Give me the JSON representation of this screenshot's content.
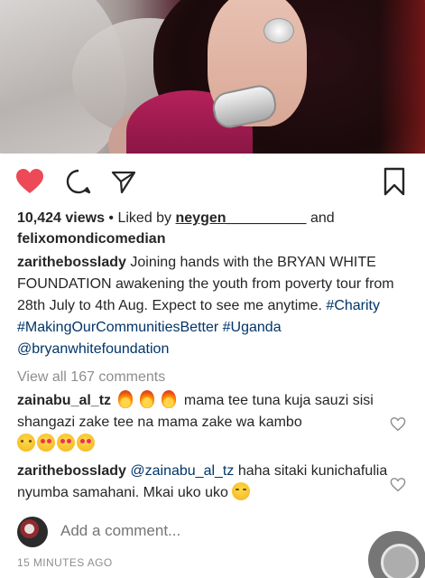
{
  "post": {
    "views": "10,424 views",
    "liked_by_prefix": " • Liked by ",
    "liked_by_user": "neygen__________",
    "liked_by_and": " and",
    "liked_by_other": "felixomondicomedian",
    "caption_user": "zarithebosslady",
    "caption_text": " Joining hands with the BRYAN WHITE FOUNDATION awakening the youth from poverty tour from 28th July to 4th Aug. Expect to see me anytime. ",
    "hashtags": [
      "#Charity",
      "#MakingOurCommunitiesBetter",
      "#Uganda"
    ],
    "mention": "@bryanwhitefoundation",
    "view_all": "View all 167 comments"
  },
  "comments": [
    {
      "user": "zainabu_al_tz",
      "text": " mama tee tuna kuja sauzi sisi shangazi zake tee na mama zake wa kambo"
    },
    {
      "user": "zarithebosslady",
      "mention": "@zainabu_al_tz",
      "text": " haha sitaki kunichafulia nyumba samahani. Mkai uko uko"
    }
  ],
  "add_comment": {
    "placeholder": "Add a comment..."
  },
  "timestamp": "15 MINUTES AGO",
  "colors": {
    "like": "#ed4956",
    "link": "#003569",
    "muted": "#8e8e8e"
  },
  "icons": [
    "heart-icon",
    "comment-icon",
    "share-icon",
    "bookmark-icon",
    "small-heart-icon"
  ]
}
